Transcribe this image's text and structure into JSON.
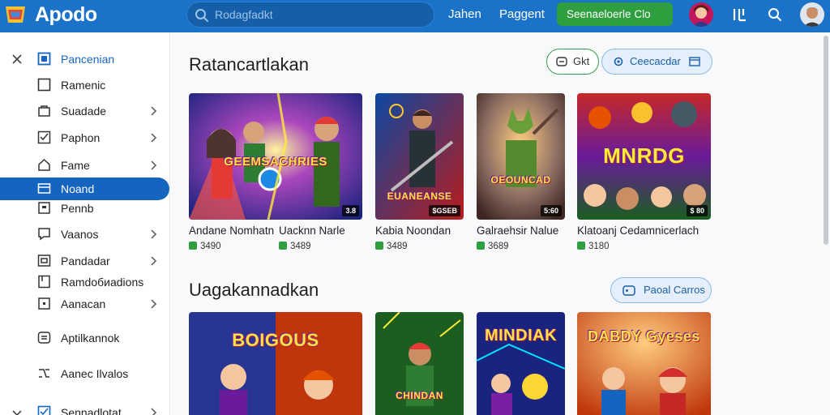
{
  "header": {
    "logo_text": "Apodo",
    "search_placeholder": "Rodagfadkt",
    "nav": [
      "Jahen",
      "Paggent"
    ],
    "cta_label": "Seenaeloerle Clo",
    "colors": {
      "bar": "#1a73c8",
      "cta": "#2e9e3e"
    },
    "icons": [
      "search-icon",
      "user-avatar",
      "library-icon",
      "search-icon",
      "profile-avatar"
    ]
  },
  "sidebar": {
    "items": [
      {
        "label": "Pancenian",
        "icon": "square-icon",
        "prefix": "close-icon",
        "chevron": false,
        "active": false
      },
      {
        "label": "Ramenic",
        "icon": "square-icon",
        "chevron": false,
        "active": false
      },
      {
        "label": "Suadade",
        "icon": "bag-icon",
        "chevron": true,
        "active": false
      },
      {
        "label": "Paphon",
        "icon": "checkbox-icon",
        "chevron": true,
        "active": false
      },
      {
        "label": "Fame",
        "icon": "home-icon",
        "chevron": true,
        "active": false
      },
      {
        "label": "Noand",
        "icon": "folder-icon",
        "chevron": false,
        "active": true
      },
      {
        "label": "Pennb",
        "icon": "doc-icon",
        "chevron": false,
        "active": false
      },
      {
        "label": "Vaanos",
        "icon": "chat-icon",
        "chevron": true,
        "active": false
      },
      {
        "label": "Pandadar",
        "icon": "window-icon",
        "chevron": true,
        "active": false
      },
      {
        "label": "Ramdoбиadions",
        "icon": "page-icon",
        "chevron": false,
        "active": false
      },
      {
        "label": "Aanacan",
        "icon": "box-icon",
        "chevron": true,
        "active": false
      },
      {
        "label": "Aptilkannok",
        "icon": "menu-icon",
        "chevron": false,
        "active": false
      },
      {
        "label": "Aanec Ilvalos",
        "icon": "shuffle-icon",
        "chevron": false,
        "active": false
      },
      {
        "label": "Sennadlotat",
        "icon": "checkbox-icon",
        "prefix": "chevron-down-icon",
        "chevron": true,
        "active": false
      }
    ],
    "active_color": "#1565c0"
  },
  "section1": {
    "title": "Ratancartlakan",
    "pill_green": "Gkt",
    "pill_blue": "Ceecacdar",
    "cards": [
      {
        "thumb_title": "GEEMSACHRIES",
        "badge": "3.8",
        "title": "Andane Nomhatn",
        "price": "3490"
      },
      {
        "thumb_title": "EUANEANSE",
        "badge": "$GSEB",
        "title": "Kabia Noondan",
        "price": "3489"
      },
      {
        "thumb_title": "OEOUNCAD",
        "badge": "5:60",
        "title": "Galraehsir Nalue",
        "price": "3689"
      },
      {
        "thumb_title": "MNRDG",
        "badge": "$ 80",
        "title": "Klatoanj Cedamnicerlach",
        "price": "3180"
      }
    ],
    "extra_label": "Uacknn Narle",
    "extra_price": "3489"
  },
  "section2": {
    "title": "Uagakannadkan",
    "pill_blue": "Paoal Carros",
    "cards": [
      {
        "thumb_title": "BOIGOUS"
      },
      {
        "thumb_title": "CHINDAN"
      },
      {
        "thumb_title": "MINDIAK"
      },
      {
        "thumb_title": "DABDY Gyeses"
      }
    ]
  }
}
